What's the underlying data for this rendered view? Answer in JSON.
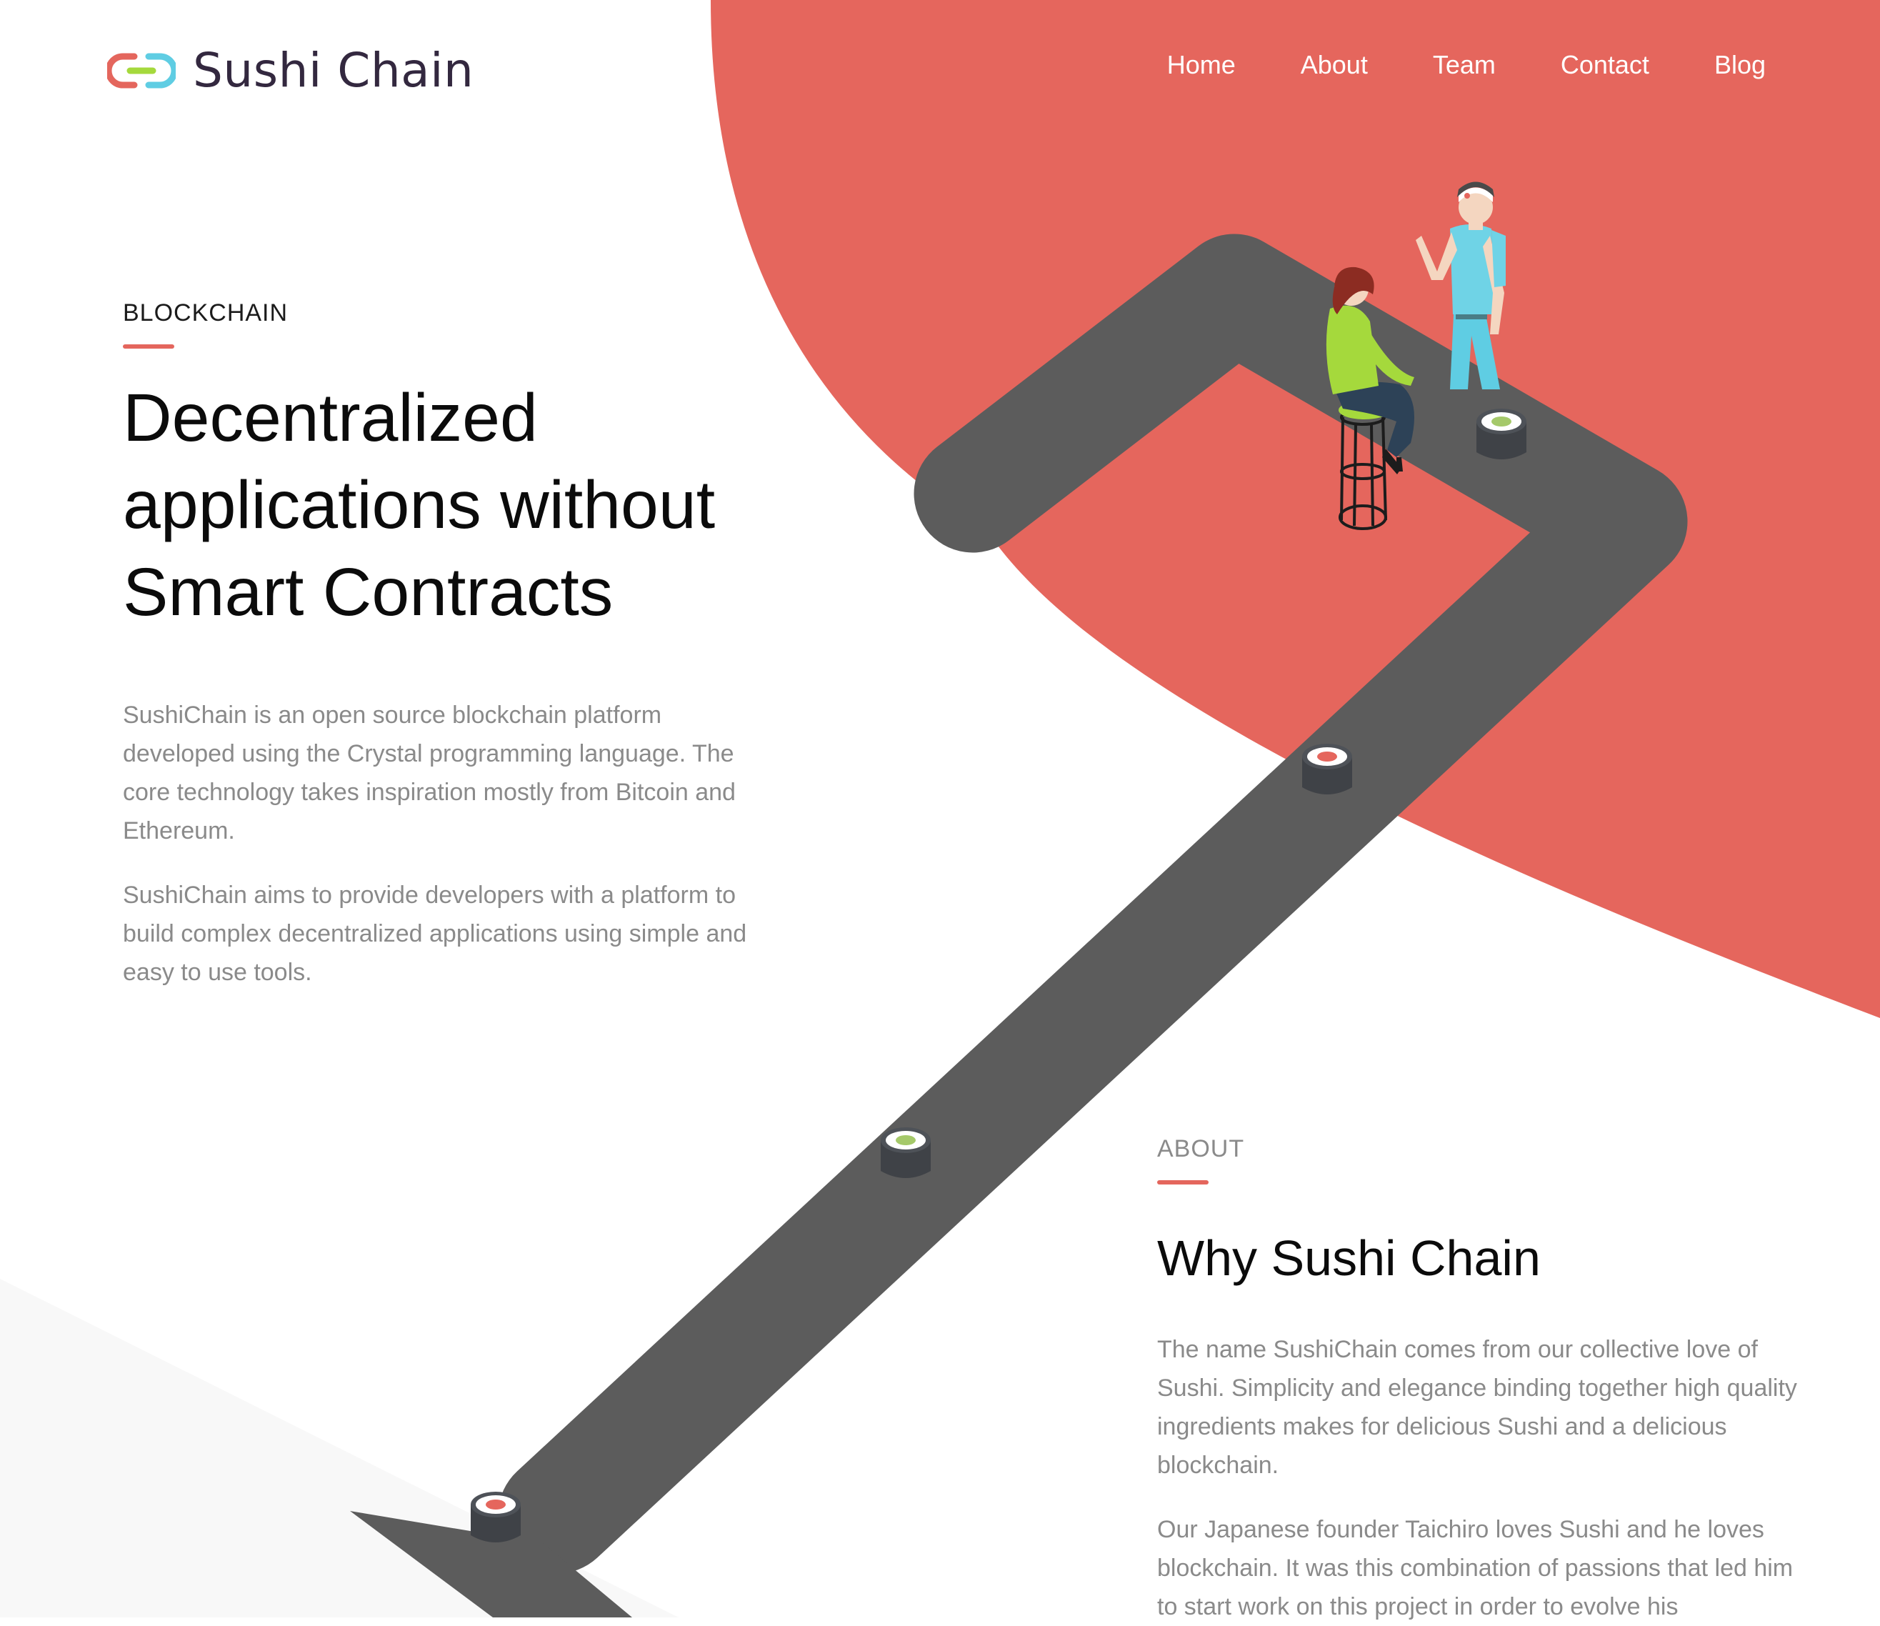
{
  "brand": {
    "name": "Sushi Chain",
    "colors": {
      "accent": "#e4665d",
      "logo_left": "#e4665d",
      "logo_link": "#a5d93c",
      "logo_right": "#5fcde3",
      "text_dark": "#33283f",
      "belt": "#5c5c5c",
      "body_text": "#8a8a8a"
    }
  },
  "nav": {
    "items": [
      {
        "label": "Home"
      },
      {
        "label": "About"
      },
      {
        "label": "Team"
      },
      {
        "label": "Contact"
      },
      {
        "label": "Blog"
      }
    ]
  },
  "hero": {
    "eyebrow": "BLOCKCHAIN",
    "title_lines": [
      "Decentralized",
      "applications without",
      "Smart Contracts"
    ],
    "paragraphs": [
      "SushiChain is an open source blockchain platform developed using the Crystal programming language. The core technology takes inspiration mostly from Bitcoin and Ethereum.",
      "SushiChain aims to provide developers with a platform to build complex decentralized applications using simple and easy to use tools."
    ]
  },
  "about": {
    "eyebrow": "ABOUT",
    "title": "Why Sushi Chain",
    "paragraphs": [
      "The name SushiChain comes from our collective love of Sushi. Simplicity and elegance binding together high quality ingredients makes for delicious Sushi and a delicious blockchain.",
      "Our Japanese founder Taichiro loves Sushi and he loves blockchain. It was this combination of passions that led him to start work on this project in order to evolve his"
    ]
  },
  "illustration": {
    "icons": [
      "conveyor-belt",
      "sushi-roll-cucumber",
      "sushi-roll-salmon",
      "chef-figure",
      "customer-figure",
      "bar-stool"
    ]
  }
}
